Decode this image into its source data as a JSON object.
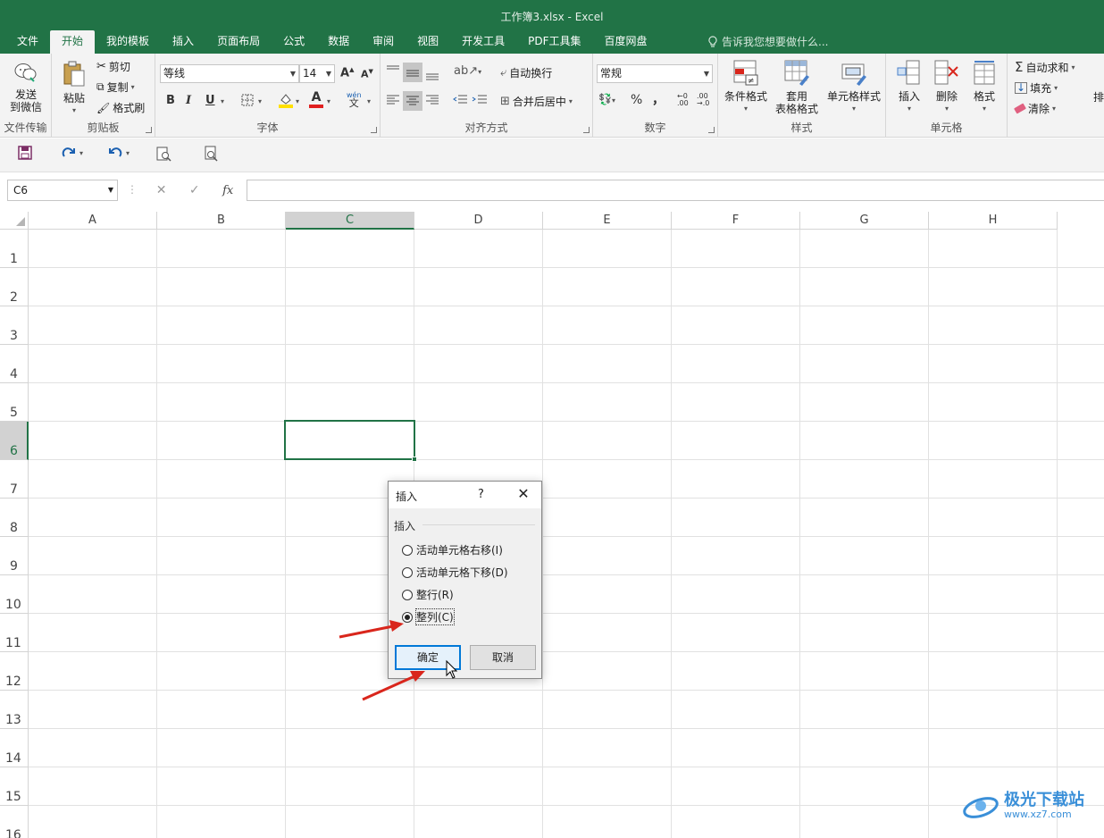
{
  "window": {
    "title": "工作簿3.xlsx - Excel"
  },
  "tabs": [
    "文件",
    "开始",
    "我的模板",
    "插入",
    "页面布局",
    "公式",
    "数据",
    "审阅",
    "视图",
    "开发工具",
    "PDF工具集",
    "百度网盘"
  ],
  "active_tab": "开始",
  "tell_me": "告诉我您想要做什么...",
  "ribbon": {
    "file_transfer": {
      "btn_line1": "发送",
      "btn_line2": "到微信",
      "label": "文件传输"
    },
    "clipboard": {
      "paste": "粘贴",
      "cut": "剪切",
      "copy": "复制",
      "format_painter": "格式刷",
      "label": "剪贴板"
    },
    "font": {
      "name": "等线",
      "size": "14",
      "bold": "B",
      "italic": "I",
      "underline": "U",
      "phonetic": "wén\n文",
      "label": "字体"
    },
    "alignment": {
      "wrap_text": "自动换行",
      "merge_center": "合并后居中",
      "label": "对齐方式"
    },
    "number": {
      "format": "常规",
      "percent": "%",
      "comma": "，",
      "label": "数字"
    },
    "styles": {
      "conditional": "条件格式",
      "table_line1": "套用",
      "table_line2": "表格格式",
      "cell_styles": "单元格样式",
      "label": "样式"
    },
    "cells": {
      "insert": "插入",
      "delete": "删除",
      "format": "格式",
      "label": "单元格"
    },
    "editing": {
      "autosum": "自动求和",
      "fill": "填充",
      "clear": "清除",
      "sort": "排"
    }
  },
  "formula_bar": {
    "name_box": "C6",
    "fx": "fx",
    "formula": ""
  },
  "grid": {
    "columns": [
      "A",
      "B",
      "C",
      "D",
      "E",
      "F",
      "G",
      "H"
    ],
    "rows": [
      "1",
      "2",
      "3",
      "4",
      "5",
      "6",
      "7",
      "8",
      "9",
      "10",
      "11",
      "12",
      "13",
      "14",
      "15",
      "16"
    ],
    "active_cell": "C6"
  },
  "dialog": {
    "title": "插入",
    "help": "?",
    "group_label": "插入",
    "options": [
      {
        "label": "活动单元格右移(I)",
        "selected": false
      },
      {
        "label": "活动单元格下移(D)",
        "selected": false
      },
      {
        "label": "整行(R)",
        "selected": false
      },
      {
        "label": "整列(C)",
        "selected": true
      }
    ],
    "ok": "确定",
    "cancel": "取消"
  },
  "watermark": {
    "name": "极光下载站",
    "url": "www.xz7.com"
  },
  "colors": {
    "excel_green": "#217346",
    "arrow_red": "#d9261c"
  }
}
